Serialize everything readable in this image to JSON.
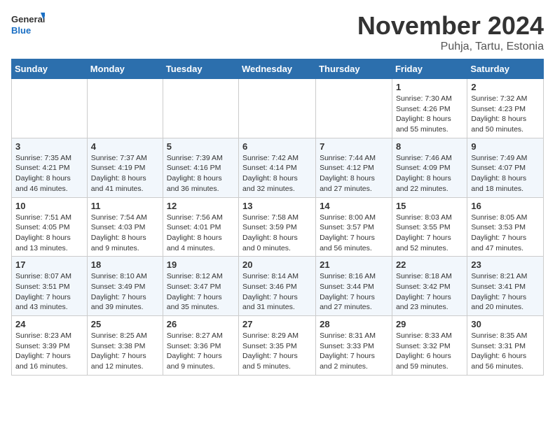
{
  "header": {
    "logo_general": "General",
    "logo_blue": "Blue",
    "month_title": "November 2024",
    "location": "Puhja, Tartu, Estonia"
  },
  "weekdays": [
    "Sunday",
    "Monday",
    "Tuesday",
    "Wednesday",
    "Thursday",
    "Friday",
    "Saturday"
  ],
  "weeks": [
    [
      {
        "day": "",
        "info": ""
      },
      {
        "day": "",
        "info": ""
      },
      {
        "day": "",
        "info": ""
      },
      {
        "day": "",
        "info": ""
      },
      {
        "day": "",
        "info": ""
      },
      {
        "day": "1",
        "info": "Sunrise: 7:30 AM\nSunset: 4:26 PM\nDaylight: 8 hours and 55 minutes."
      },
      {
        "day": "2",
        "info": "Sunrise: 7:32 AM\nSunset: 4:23 PM\nDaylight: 8 hours and 50 minutes."
      }
    ],
    [
      {
        "day": "3",
        "info": "Sunrise: 7:35 AM\nSunset: 4:21 PM\nDaylight: 8 hours and 46 minutes."
      },
      {
        "day": "4",
        "info": "Sunrise: 7:37 AM\nSunset: 4:19 PM\nDaylight: 8 hours and 41 minutes."
      },
      {
        "day": "5",
        "info": "Sunrise: 7:39 AM\nSunset: 4:16 PM\nDaylight: 8 hours and 36 minutes."
      },
      {
        "day": "6",
        "info": "Sunrise: 7:42 AM\nSunset: 4:14 PM\nDaylight: 8 hours and 32 minutes."
      },
      {
        "day": "7",
        "info": "Sunrise: 7:44 AM\nSunset: 4:12 PM\nDaylight: 8 hours and 27 minutes."
      },
      {
        "day": "8",
        "info": "Sunrise: 7:46 AM\nSunset: 4:09 PM\nDaylight: 8 hours and 22 minutes."
      },
      {
        "day": "9",
        "info": "Sunrise: 7:49 AM\nSunset: 4:07 PM\nDaylight: 8 hours and 18 minutes."
      }
    ],
    [
      {
        "day": "10",
        "info": "Sunrise: 7:51 AM\nSunset: 4:05 PM\nDaylight: 8 hours and 13 minutes."
      },
      {
        "day": "11",
        "info": "Sunrise: 7:54 AM\nSunset: 4:03 PM\nDaylight: 8 hours and 9 minutes."
      },
      {
        "day": "12",
        "info": "Sunrise: 7:56 AM\nSunset: 4:01 PM\nDaylight: 8 hours and 4 minutes."
      },
      {
        "day": "13",
        "info": "Sunrise: 7:58 AM\nSunset: 3:59 PM\nDaylight: 8 hours and 0 minutes."
      },
      {
        "day": "14",
        "info": "Sunrise: 8:00 AM\nSunset: 3:57 PM\nDaylight: 7 hours and 56 minutes."
      },
      {
        "day": "15",
        "info": "Sunrise: 8:03 AM\nSunset: 3:55 PM\nDaylight: 7 hours and 52 minutes."
      },
      {
        "day": "16",
        "info": "Sunrise: 8:05 AM\nSunset: 3:53 PM\nDaylight: 7 hours and 47 minutes."
      }
    ],
    [
      {
        "day": "17",
        "info": "Sunrise: 8:07 AM\nSunset: 3:51 PM\nDaylight: 7 hours and 43 minutes."
      },
      {
        "day": "18",
        "info": "Sunrise: 8:10 AM\nSunset: 3:49 PM\nDaylight: 7 hours and 39 minutes."
      },
      {
        "day": "19",
        "info": "Sunrise: 8:12 AM\nSunset: 3:47 PM\nDaylight: 7 hours and 35 minutes."
      },
      {
        "day": "20",
        "info": "Sunrise: 8:14 AM\nSunset: 3:46 PM\nDaylight: 7 hours and 31 minutes."
      },
      {
        "day": "21",
        "info": "Sunrise: 8:16 AM\nSunset: 3:44 PM\nDaylight: 7 hours and 27 minutes."
      },
      {
        "day": "22",
        "info": "Sunrise: 8:18 AM\nSunset: 3:42 PM\nDaylight: 7 hours and 23 minutes."
      },
      {
        "day": "23",
        "info": "Sunrise: 8:21 AM\nSunset: 3:41 PM\nDaylight: 7 hours and 20 minutes."
      }
    ],
    [
      {
        "day": "24",
        "info": "Sunrise: 8:23 AM\nSunset: 3:39 PM\nDaylight: 7 hours and 16 minutes."
      },
      {
        "day": "25",
        "info": "Sunrise: 8:25 AM\nSunset: 3:38 PM\nDaylight: 7 hours and 12 minutes."
      },
      {
        "day": "26",
        "info": "Sunrise: 8:27 AM\nSunset: 3:36 PM\nDaylight: 7 hours and 9 minutes."
      },
      {
        "day": "27",
        "info": "Sunrise: 8:29 AM\nSunset: 3:35 PM\nDaylight: 7 hours and 5 minutes."
      },
      {
        "day": "28",
        "info": "Sunrise: 8:31 AM\nSunset: 3:33 PM\nDaylight: 7 hours and 2 minutes."
      },
      {
        "day": "29",
        "info": "Sunrise: 8:33 AM\nSunset: 3:32 PM\nDaylight: 6 hours and 59 minutes."
      },
      {
        "day": "30",
        "info": "Sunrise: 8:35 AM\nSunset: 3:31 PM\nDaylight: 6 hours and 56 minutes."
      }
    ]
  ]
}
